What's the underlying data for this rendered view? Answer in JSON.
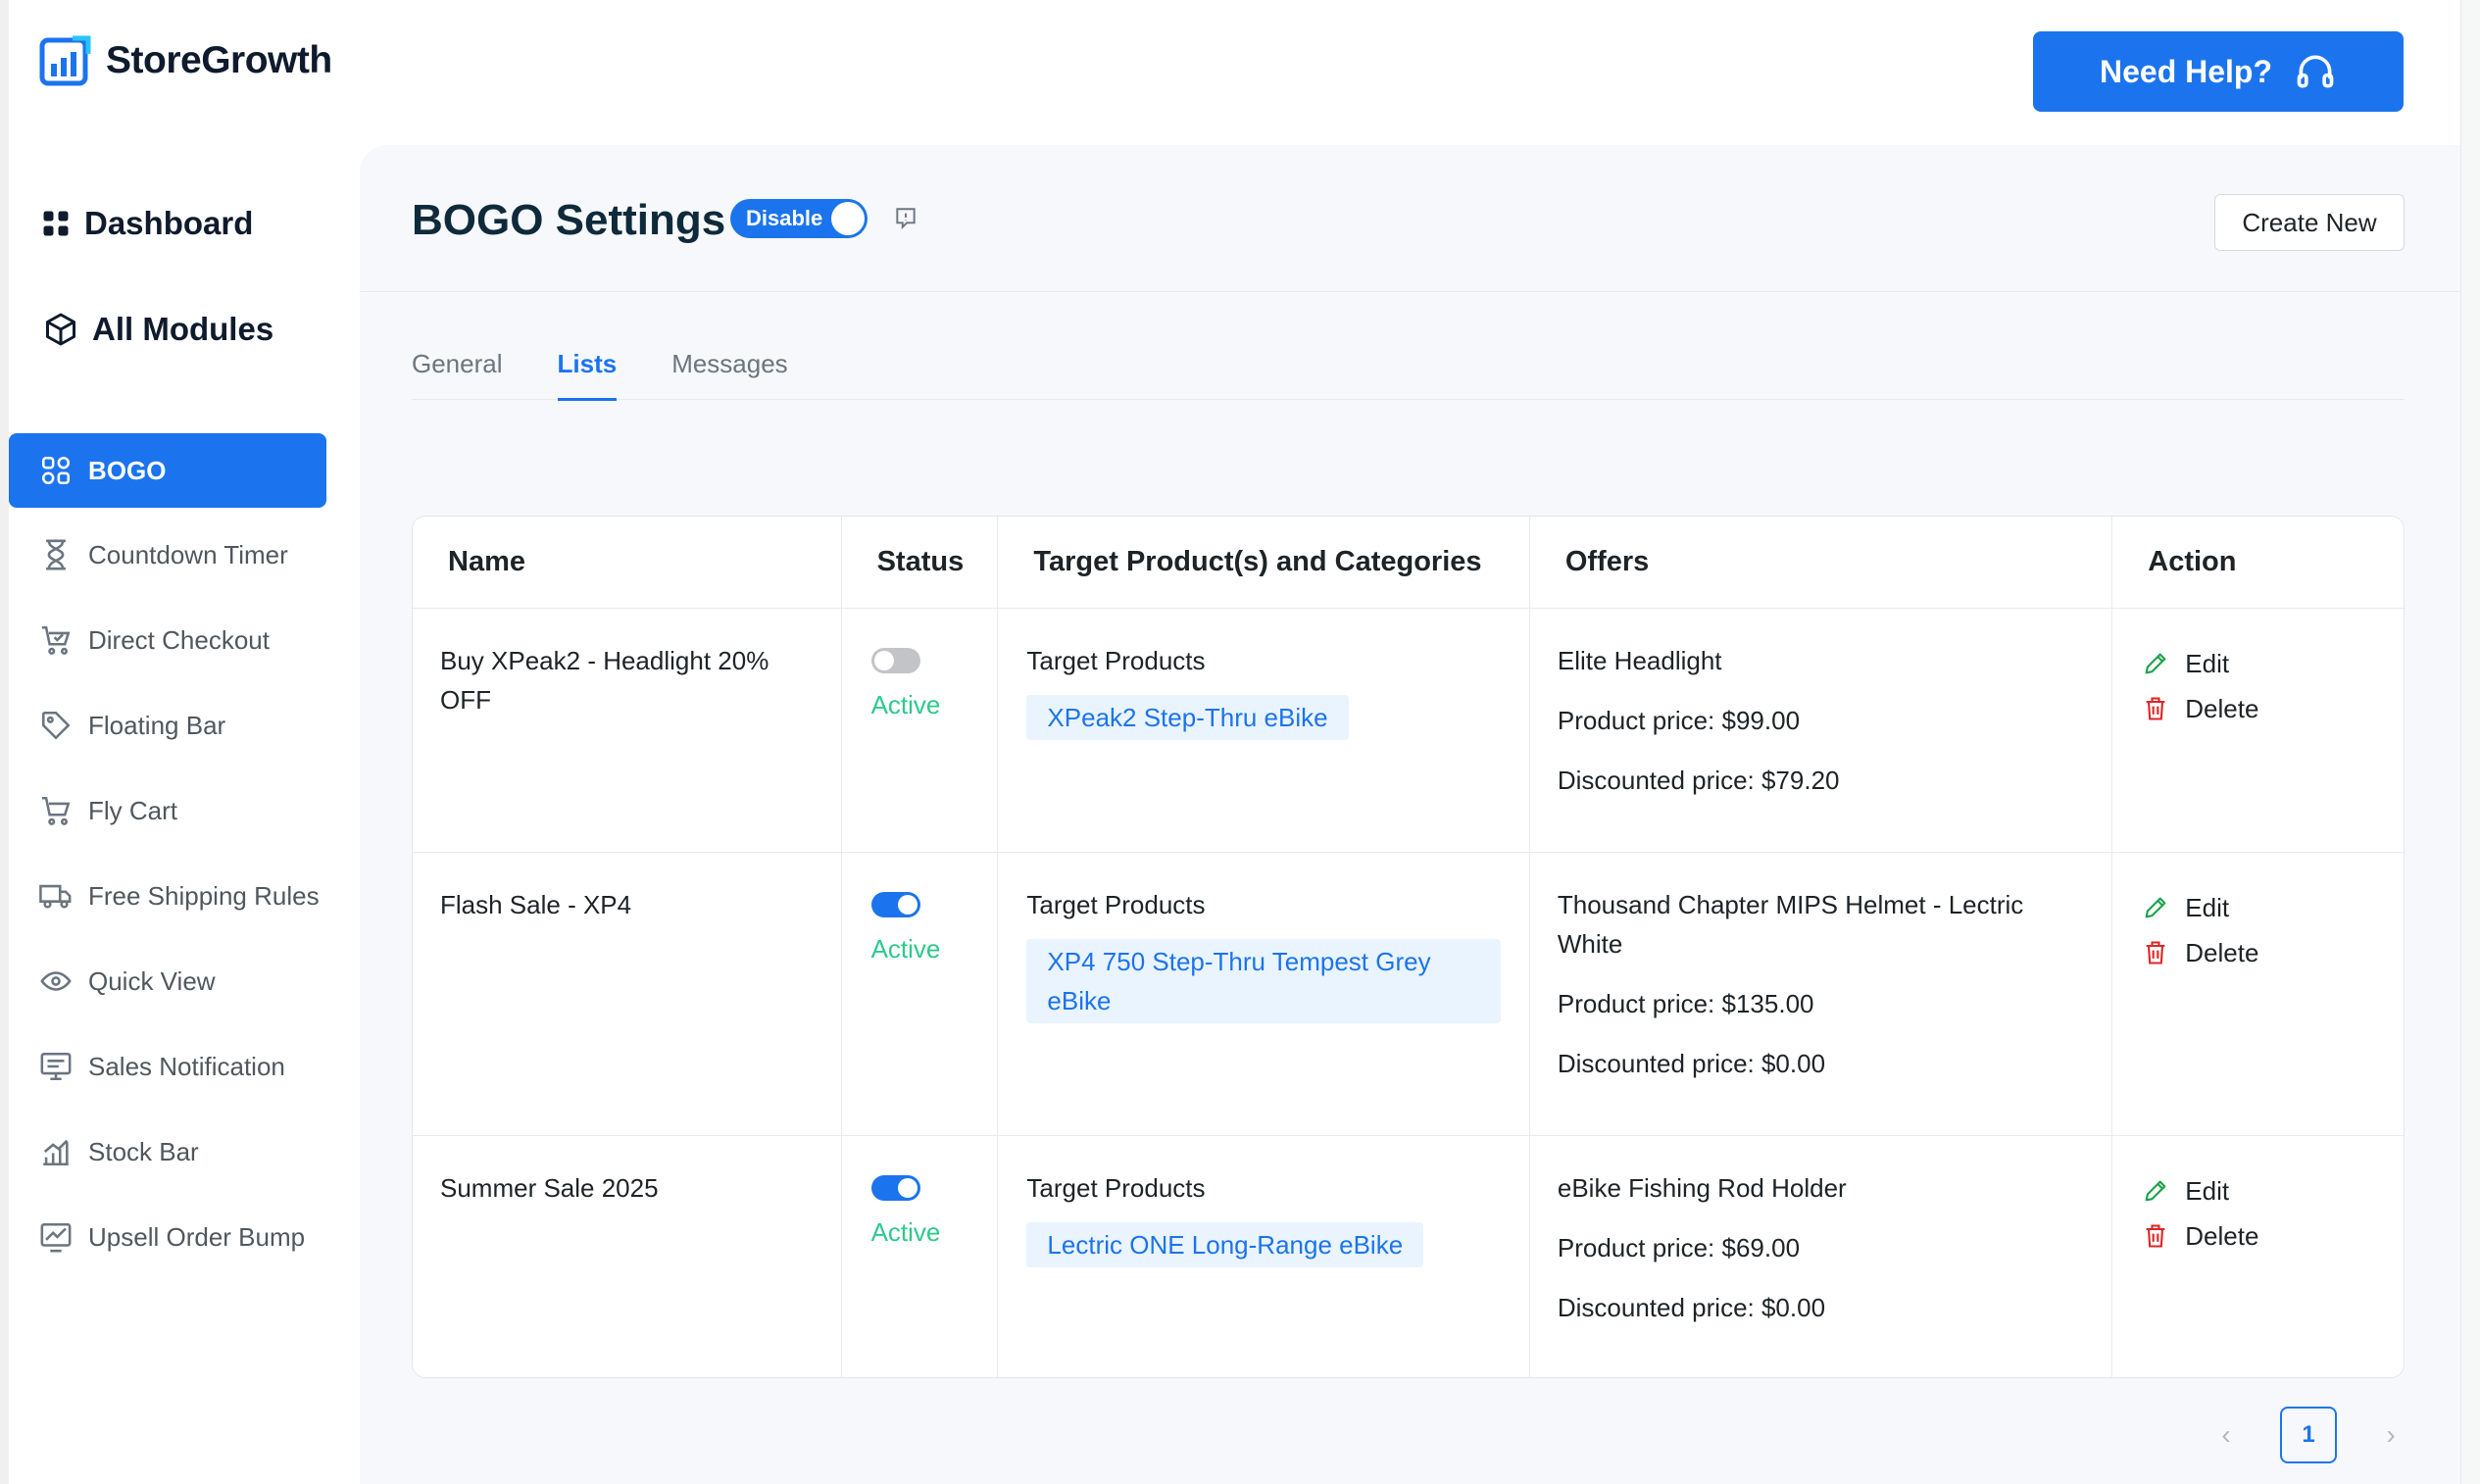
{
  "brand": {
    "name": "StoreGrowth"
  },
  "header": {
    "help_label": "Need Help?"
  },
  "sidebar": {
    "dashboard": "Dashboard",
    "all_modules": "All Modules",
    "items": [
      {
        "label": "BOGO",
        "icon": "bogo-icon",
        "active": true
      },
      {
        "label": "Countdown Timer",
        "icon": "hourglass-icon"
      },
      {
        "label": "Direct Checkout",
        "icon": "cart-icon"
      },
      {
        "label": "Floating Bar",
        "icon": "tag-icon"
      },
      {
        "label": "Fly Cart",
        "icon": "cart-icon"
      },
      {
        "label": "Free Shipping Rules",
        "icon": "truck-icon"
      },
      {
        "label": "Quick View",
        "icon": "eye-icon"
      },
      {
        "label": "Sales Notification",
        "icon": "notification-icon"
      },
      {
        "label": "Stock Bar",
        "icon": "bar-chart-icon"
      },
      {
        "label": "Upsell Order Bump",
        "icon": "trend-icon"
      }
    ]
  },
  "page": {
    "title": "BOGO Settings",
    "module_toggle": "Disable",
    "create_label": "Create New"
  },
  "tabs": [
    {
      "label": "General"
    },
    {
      "label": "Lists",
      "active": true
    },
    {
      "label": "Messages"
    }
  ],
  "table": {
    "columns": [
      "Name",
      "Status",
      "Target Product(s) and Categories",
      "Offers",
      "Action"
    ],
    "rows": [
      {
        "name_line1": "Buy XPeak2 - Headlight 20%",
        "name_line2": "OFF",
        "enabled": false,
        "status": "Active",
        "target_label": "Target Products",
        "target_product": "XPeak2 Step-Thru eBike",
        "offer_name": "Elite Headlight",
        "offer_name2": "",
        "product_price": "Product price: $99.00",
        "discounted_price": "Discounted price: $79.20",
        "edit": "Edit",
        "delete": "Delete"
      },
      {
        "name_line1": "Flash Sale - XP4",
        "name_line2": "",
        "enabled": true,
        "status": "Active",
        "target_label": "Target Products",
        "target_product": "XP4 750 Step-Thru Tempest Grey eBike",
        "offer_name": "Thousand Chapter MIPS Helmet - Lectric",
        "offer_name2": "White",
        "product_price": "Product price: $135.00",
        "discounted_price": "Discounted price: $0.00",
        "edit": "Edit",
        "delete": "Delete"
      },
      {
        "name_line1": "Summer Sale 2025",
        "name_line2": "",
        "enabled": true,
        "status": "Active",
        "target_label": "Target Products",
        "target_product": "Lectric ONE Long-Range eBike",
        "offer_name": "eBike Fishing Rod Holder",
        "offer_name2": "",
        "product_price": "Product price: $69.00",
        "discounted_price": "Discounted price: $0.00",
        "edit": "Edit",
        "delete": "Delete"
      }
    ]
  },
  "pagination": {
    "prev": "‹",
    "current": "1",
    "next": "›"
  },
  "colors": {
    "accent": "#1b74ee",
    "active_status": "#2ec98c",
    "delete": "#e02424",
    "edit": "#1aa34a"
  }
}
